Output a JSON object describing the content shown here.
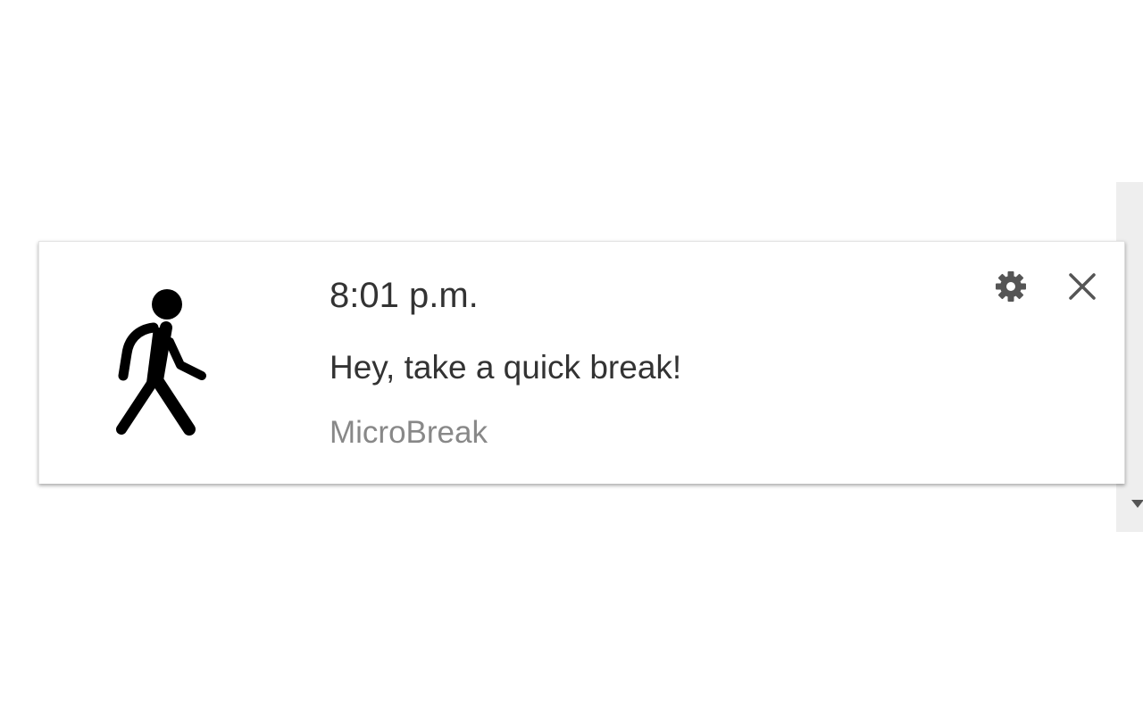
{
  "notification": {
    "time": "8:01 p.m.",
    "message": "Hey, take a quick break!",
    "source": "MicroBreak",
    "app_icon": "walking-person-icon",
    "settings_icon": "gear-icon",
    "close_icon": "close-icon"
  },
  "colors": {
    "background": "#ffffff",
    "primary_text": "#333333",
    "secondary_text": "#888888",
    "icon": "#555555",
    "scroll_track": "#eeeeee"
  }
}
